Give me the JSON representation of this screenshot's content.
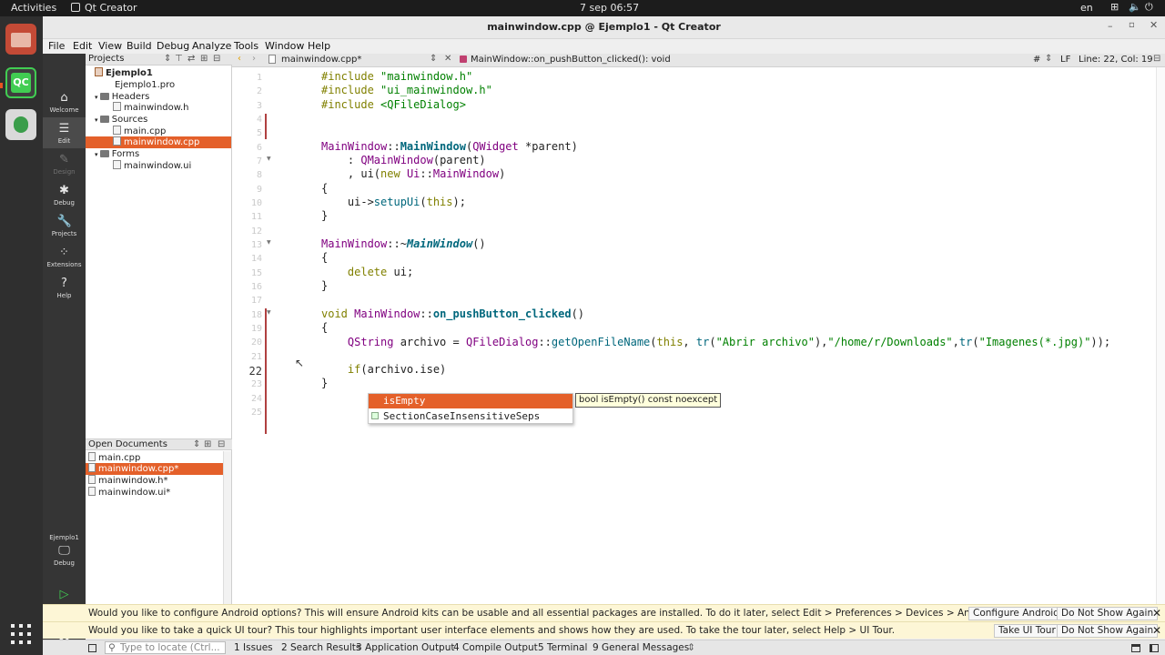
{
  "system": {
    "activities": "Activities",
    "app_name": "Qt Creator",
    "datetime": "7 sep  06:57",
    "lang": "en"
  },
  "window": {
    "title": "mainwindow.cpp @ Ejemplo1 - Qt Creator"
  },
  "menu": [
    "File",
    "Edit",
    "View",
    "Build",
    "Debug",
    "Analyze",
    "Tools",
    "Window",
    "Help"
  ],
  "modes": [
    {
      "label": "Welcome",
      "icon": "home-icon"
    },
    {
      "label": "Edit",
      "icon": "edit-icon"
    },
    {
      "label": "Design",
      "icon": "design-icon"
    },
    {
      "label": "Debug",
      "icon": "debug-icon"
    },
    {
      "label": "Projects",
      "icon": "wrench-icon"
    },
    {
      "label": "Extensions",
      "icon": "extensions-icon"
    },
    {
      "label": "Help",
      "icon": "help-icon"
    }
  ],
  "kit": {
    "project": "Ejemplo1",
    "config": "Debug"
  },
  "projects": {
    "header": "Projects",
    "tree": [
      {
        "label": "Ejemplo1",
        "type": "project"
      },
      {
        "label": "Ejemplo1.pro",
        "type": "file"
      },
      {
        "label": "Headers",
        "type": "folder"
      },
      {
        "label": "mainwindow.h",
        "type": "file"
      },
      {
        "label": "Sources",
        "type": "folder"
      },
      {
        "label": "main.cpp",
        "type": "file"
      },
      {
        "label": "mainwindow.cpp",
        "type": "file",
        "selected": true
      },
      {
        "label": "Forms",
        "type": "folder"
      },
      {
        "label": "mainwindow.ui",
        "type": "file"
      }
    ]
  },
  "open_documents": {
    "header": "Open Documents",
    "items": [
      {
        "label": "main.cpp"
      },
      {
        "label": "mainwindow.cpp*",
        "selected": true
      },
      {
        "label": "mainwindow.h*"
      },
      {
        "label": "mainwindow.ui*"
      }
    ]
  },
  "editor": {
    "file_tab": "mainwindow.cpp*",
    "symbol": "MainWindow::on_pushButton_clicked(): void",
    "hash": "#",
    "line_ending": "LF",
    "position": "Line: 22, Col: 19",
    "line_numbers": [
      "1",
      "2",
      "3",
      "4",
      "5",
      "6",
      "7",
      "8",
      "9",
      "10",
      "11",
      "12",
      "13",
      "14",
      "15",
      "16",
      "17",
      "18",
      "19",
      "20",
      "21",
      "22",
      "23",
      "24",
      "25"
    ],
    "code": {
      "l1a": "#include ",
      "l1b": "\"mainwindow.h\"",
      "l2a": "#include ",
      "l2b": "\"ui_mainwindow.h\"",
      "l3a": "#include ",
      "l3b": "<QFileDialog>",
      "l6a": "MainWindow",
      "l6b": "::",
      "l6c": "MainWindow",
      "l6d": "(",
      "l6e": "QWidget",
      "l6f": " *parent)",
      "l7a": "    : ",
      "l7b": "QMainWindow",
      "l7c": "(parent)",
      "l8a": "    , ui(",
      "l8b": "new",
      "l8c": " ",
      "l8d": "Ui",
      "l8e": "::",
      "l8f": "MainWindow",
      "l8g": ")",
      "l9": "{",
      "l10a": "    ui->",
      "l10b": "setupUi",
      "l10c": "(",
      "l10d": "this",
      "l10e": ");",
      "l11": "}",
      "l13a": "MainWindow",
      "l13b": "::~",
      "l13c": "MainWindow",
      "l13d": "()",
      "l14": "{",
      "l15a": "    ",
      "l15b": "delete",
      "l15c": " ui;",
      "l16": "}",
      "l18a": "void",
      "l18b": " ",
      "l18c": "MainWindow",
      "l18d": "::",
      "l18e": "on_pushButton_clicked",
      "l18f": "()",
      "l19": "{",
      "l20a": "    ",
      "l20b": "QString",
      "l20c": " archivo = ",
      "l20d": "QFileDialog",
      "l20e": "::",
      "l20f": "getOpenFileName",
      "l20g": "(",
      "l20h": "this",
      "l20i": ", ",
      "l20j": "tr",
      "l20k": "(",
      "l20l": "\"Abrir archivo\"",
      "l20m": "),",
      "l20n": "\"/home/r/Downloads\"",
      "l20o": ",",
      "l20p": "tr",
      "l20q": "(",
      "l20r": "\"Imagenes(*.jpg)\"",
      "l20s": "));",
      "l22a": "    ",
      "l22b": "if",
      "l22c": "(archivo.ise)",
      "l23": "}"
    }
  },
  "completion": {
    "items": [
      "isEmpty",
      "SectionCaseInsensitiveSeps"
    ],
    "tooltip": "bool isEmpty() const noexcept"
  },
  "infobars": [
    {
      "text": "Would you like to configure Android options? This will ensure Android kits can be usable and all essential packages are installed. To do it later, select Edit > Preferences > Devices > Android.",
      "btn1": "Configure Android",
      "btn2": "Do Not Show Again"
    },
    {
      "text": "Would you like to take a quick UI tour? This tour highlights important user interface elements and shows how they are used. To take the tour later, select Help > UI Tour.",
      "btn1": "Take UI Tour",
      "btn2": "Do Not Show Again"
    }
  ],
  "statusbar": {
    "locator_placeholder": "Type to locate (Ctrl...",
    "tabs": [
      "1  Issues",
      "2  Search Results",
      "3  Application Output",
      "4  Compile Output",
      "5  Terminal",
      "9  General Messages"
    ]
  }
}
